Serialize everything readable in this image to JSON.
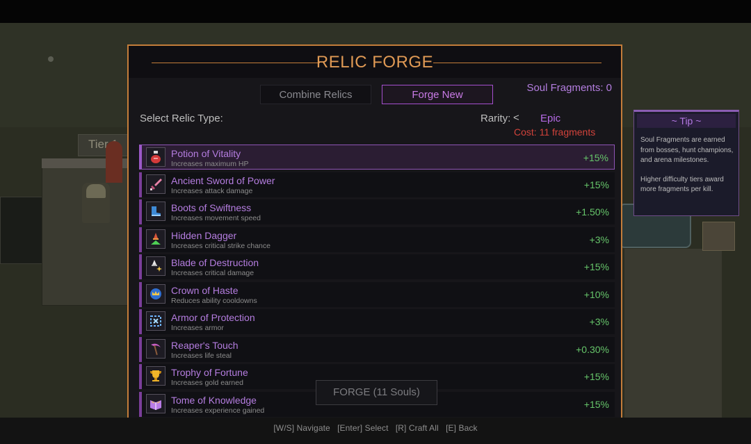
{
  "scene": {
    "tier_sign": "Tier 1"
  },
  "panel": {
    "title": "RELIC FORGE",
    "tabs": [
      {
        "label": "Combine Relics",
        "active": false
      },
      {
        "label": "Forge New",
        "active": true
      }
    ],
    "soul_fragments": "Soul Fragments: 0",
    "select_label": "Select Relic Type:",
    "rarity": {
      "label": "Rarity:",
      "arrow": "<",
      "value": "Epic"
    },
    "cost": "Cost: 11 fragments",
    "relics": [
      {
        "name": "Potion of Vitality",
        "desc": "Increases maximum HP",
        "bonus": "+15%",
        "icon": "potion-icon",
        "selected": true
      },
      {
        "name": "Ancient Sword of Power",
        "desc": "Increases attack damage",
        "bonus": "+15%",
        "icon": "sword-icon"
      },
      {
        "name": "Boots of Swiftness",
        "desc": "Increases movement speed",
        "bonus": "+1.50%",
        "icon": "boots-icon"
      },
      {
        "name": "Hidden Dagger",
        "desc": "Increases critical strike chance",
        "bonus": "+3%",
        "icon": "dagger-icon"
      },
      {
        "name": "Blade of Destruction",
        "desc": "Increases critical damage",
        "bonus": "+15%",
        "icon": "blade-icon"
      },
      {
        "name": "Crown of Haste",
        "desc": "Reduces ability cooldowns",
        "bonus": "+10%",
        "icon": "crown-icon"
      },
      {
        "name": "Armor of Protection",
        "desc": "Increases armor",
        "bonus": "+3%",
        "icon": "armor-icon"
      },
      {
        "name": "Reaper's Touch",
        "desc": "Increases life steal",
        "bonus": "+0.30%",
        "icon": "scythe-icon"
      },
      {
        "name": "Trophy of Fortune",
        "desc": "Increases gold earned",
        "bonus": "+15%",
        "icon": "trophy-icon"
      },
      {
        "name": "Tome of Knowledge",
        "desc": "Increases experience gained",
        "bonus": "+15%",
        "icon": "tome-icon"
      }
    ],
    "forge_button": "FORGE (11 Souls)"
  },
  "tip": {
    "title": "~ Tip ~",
    "lines": [
      "Soul Fragments are earned from bosses, hunt champions, and arena milestones.",
      "Higher difficulty tiers award more fragments per kill."
    ]
  },
  "controls": "[W/S] Navigate   [Enter] Select   [R] Craft All   [E] Back",
  "colors": {
    "panel_border": "#c47d3a",
    "title": "#e09a55",
    "relic_name": "#b57de0",
    "bonus": "#66c56a",
    "cost": "#d3433b",
    "accent_purple": "#a64fcf"
  }
}
